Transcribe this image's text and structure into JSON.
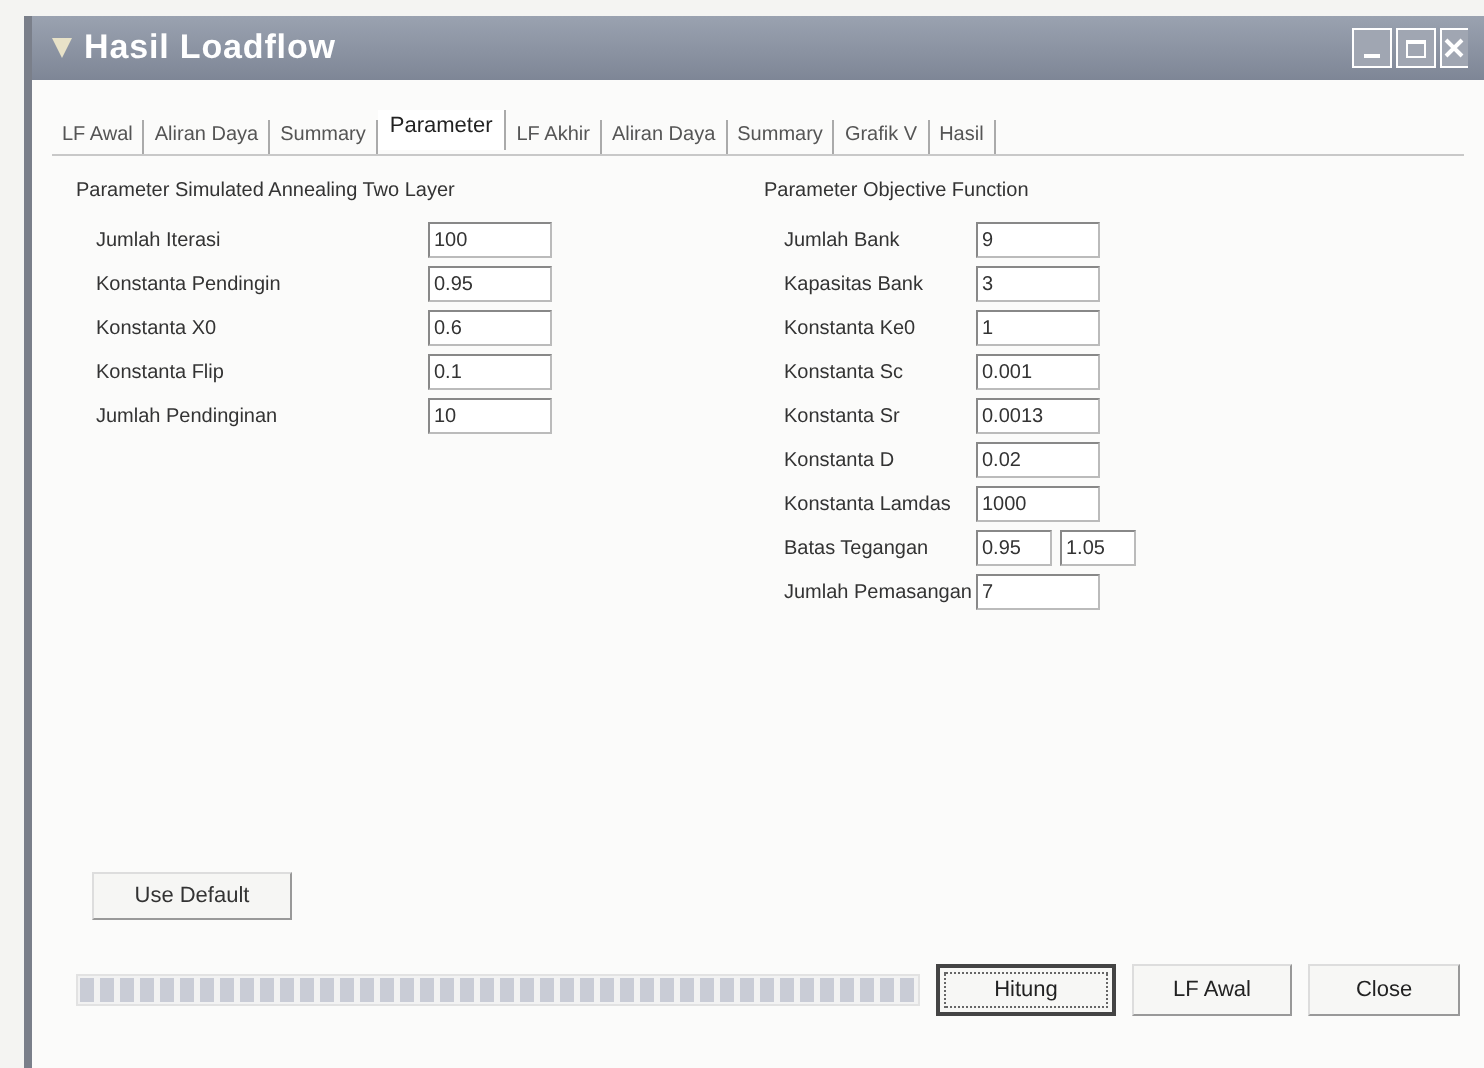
{
  "window": {
    "title": "Hasil Loadflow"
  },
  "tabs": [
    {
      "label": "LF Awal",
      "selected": false
    },
    {
      "label": "Aliran Daya",
      "selected": false
    },
    {
      "label": "Summary",
      "selected": false
    },
    {
      "label": "Parameter",
      "selected": true
    },
    {
      "label": "LF Akhir",
      "selected": false
    },
    {
      "label": "Aliran Daya",
      "selected": false
    },
    {
      "label": "Summary",
      "selected": false
    },
    {
      "label": "Grafik V",
      "selected": false
    },
    {
      "label": "Hasil",
      "selected": false
    }
  ],
  "left_group": {
    "title": "Parameter Simulated Annealing Two Layer",
    "fields": [
      {
        "label": "Jumlah Iterasi",
        "values": [
          "100"
        ]
      },
      {
        "label": "Konstanta Pendingin",
        "values": [
          "0.95"
        ]
      },
      {
        "label": "Konstanta X0",
        "values": [
          "0.6"
        ]
      },
      {
        "label": "Konstanta Flip",
        "values": [
          "0.1"
        ]
      },
      {
        "label": "Jumlah Pendinginan",
        "values": [
          "10"
        ]
      }
    ]
  },
  "right_group": {
    "title": "Parameter Objective Function",
    "fields": [
      {
        "label": "Jumlah Bank",
        "values": [
          "9"
        ]
      },
      {
        "label": "Kapasitas Bank",
        "values": [
          "3"
        ]
      },
      {
        "label": "Konstanta Ke0",
        "values": [
          "1"
        ]
      },
      {
        "label": "Konstanta Sc",
        "values": [
          "0.001"
        ]
      },
      {
        "label": "Konstanta Sr",
        "values": [
          "0.0013"
        ]
      },
      {
        "label": "Konstanta D",
        "values": [
          "0.02"
        ]
      },
      {
        "label": "Konstanta Lamdas",
        "values": [
          "1000"
        ]
      },
      {
        "label": "Batas Tegangan",
        "values": [
          "0.95",
          "1.05"
        ]
      },
      {
        "label": "Jumlah Pemasangan",
        "values": [
          "7"
        ]
      }
    ]
  },
  "use_default_button": "Use Default",
  "progress": {
    "level": 1
  },
  "buttons": [
    {
      "label": "Hitung",
      "selected": true
    },
    {
      "label": "LF Awal",
      "selected": false
    },
    {
      "label": "Close",
      "selected": false
    }
  ]
}
